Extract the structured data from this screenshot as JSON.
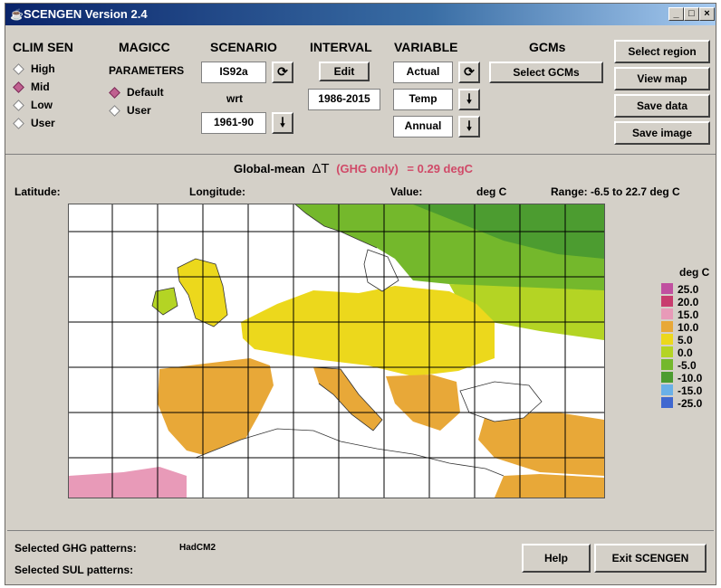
{
  "window": {
    "title": "SCENGEN Version 2.4",
    "min_label": "_",
    "max_label": "□",
    "close_label": "×"
  },
  "clim_sen": {
    "header": "CLIM SEN",
    "options": [
      "High",
      "Mid",
      "Low",
      "User"
    ],
    "selected": "Mid"
  },
  "magicc": {
    "header": "MAGICC",
    "subheader": "PARAMETERS",
    "options": [
      "Default",
      "User"
    ],
    "selected": "Default"
  },
  "scenario": {
    "header": "SCENARIO",
    "value": "IS92a",
    "wrt_label": "wrt",
    "ref_value": "1961-90"
  },
  "interval": {
    "header": "INTERVAL",
    "edit_label": "Edit",
    "value": "1986-2015"
  },
  "variable": {
    "header": "VARIABLE",
    "mode": "Actual",
    "var": "Temp",
    "season": "Annual"
  },
  "gcms": {
    "header": "GCMs",
    "select_label": "Select GCMs"
  },
  "actions": {
    "select_region": "Select region",
    "view_map": "View map",
    "save_data": "Save data",
    "save_image": "Save image"
  },
  "global_mean": {
    "prefix": "Global-mean",
    "delta": "ΔT",
    "note": "(GHG only)",
    "value": "= 0.29 degC"
  },
  "readout": {
    "latitude_label": "Latitude:",
    "longitude_label": "Longitude:",
    "value_label": "Value:",
    "unit": "deg C",
    "range_text": "Range: -6.5 to 22.7  deg C"
  },
  "legend": {
    "title": "deg C",
    "items": [
      {
        "label": "25.0",
        "color": "#c050a0"
      },
      {
        "label": "20.0",
        "color": "#c83c6e"
      },
      {
        "label": "15.0",
        "color": "#e89ab8"
      },
      {
        "label": "10.0",
        "color": "#e8a838"
      },
      {
        "label": "5.0",
        "color": "#ecd81c"
      },
      {
        "label": "0.0",
        "color": "#b4d424"
      },
      {
        "label": "-5.0",
        "color": "#74b82c"
      },
      {
        "label": "-10.0",
        "color": "#4c9c30"
      },
      {
        "label": "-15.0",
        "color": "#6ab0e8"
      },
      {
        "label": "-25.0",
        "color": "#4068d0"
      }
    ]
  },
  "footer": {
    "ghg_label": "Selected GHG patterns:",
    "ghg_value": "HadCM2",
    "sul_label": "Selected SUL patterns:",
    "sul_value": "",
    "help_label": "Help",
    "exit_label": "Exit SCENGEN"
  },
  "colors": {
    "accent": "#c06090",
    "title_bar": "#0a246a",
    "ghg_note": "#d04a68"
  }
}
